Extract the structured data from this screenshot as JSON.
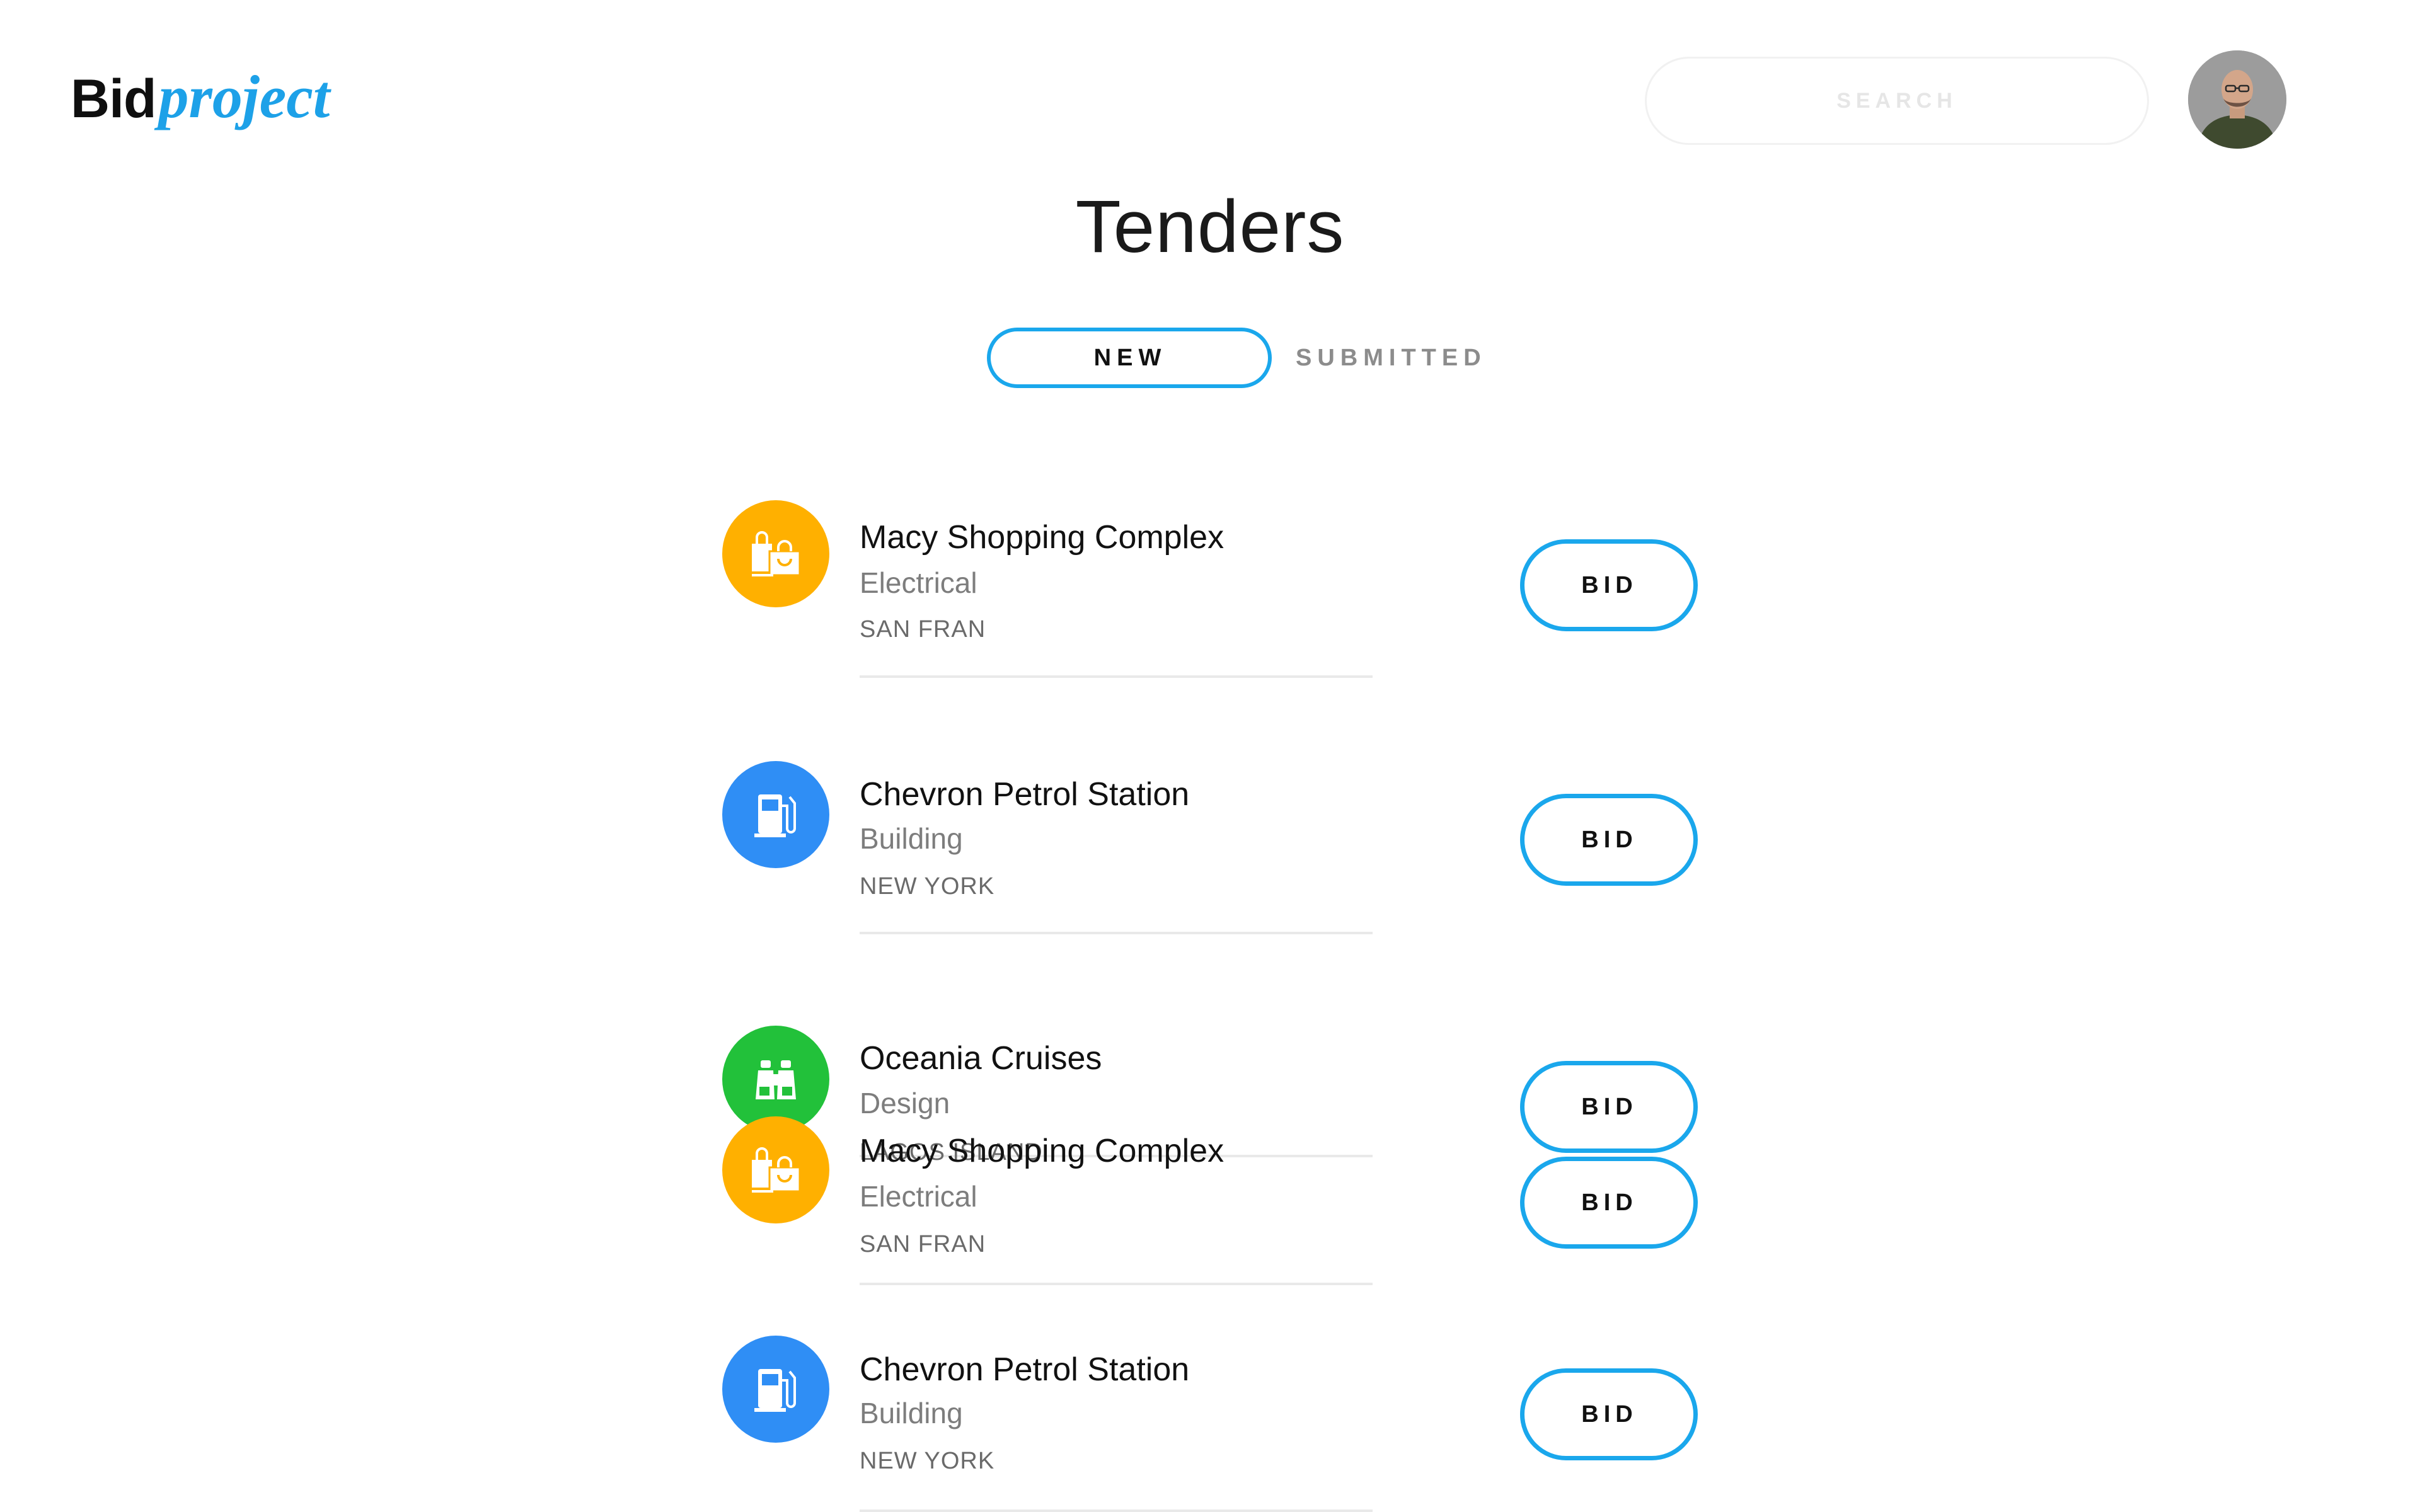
{
  "header": {
    "logo_main": "Bid",
    "logo_accent": "project",
    "search_placeholder": "SEARCH"
  },
  "page": {
    "title": "Tenders"
  },
  "tabs": [
    {
      "label": "NEW",
      "active": true
    },
    {
      "label": "SUBMITTED",
      "active": false
    }
  ],
  "colors": {
    "accent": "#1aa7ec",
    "shopping": "#ffb000",
    "fuel": "#2f8ef5",
    "travel": "#22c13a"
  },
  "tenders": [
    {
      "name": "Macy Shopping Complex",
      "category": "Electrical",
      "location": "SAN FRAN",
      "icon": "shopping-bags-icon",
      "bid_label": "BID"
    },
    {
      "name": "Chevron Petrol Station",
      "category": "Building",
      "location": "NEW YORK",
      "icon": "fuel-pump-icon",
      "bid_label": "BID"
    },
    {
      "name": "Oceania Cruises",
      "category": "Design",
      "location": "LAGOS ISLAND",
      "icon": "binoculars-icon",
      "bid_label": "BID"
    },
    {
      "name": "Macy Shopping Complex",
      "category": "Electrical",
      "location": "SAN FRAN",
      "icon": "shopping-bags-icon",
      "bid_label": "BID"
    },
    {
      "name": "Chevron Petrol Station",
      "category": "Building",
      "location": "NEW YORK",
      "icon": "fuel-pump-icon",
      "bid_label": "BID"
    }
  ]
}
